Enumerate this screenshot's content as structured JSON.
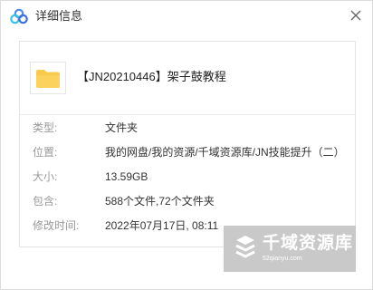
{
  "window": {
    "title": "详细信息",
    "close_symbol": "×",
    "icons": {
      "app": "cloud-logo-icon",
      "close": "close-icon"
    }
  },
  "file": {
    "name": "【JN20210446】架子鼓教程",
    "icon": "folder-icon",
    "icon_color": "#f8c94b"
  },
  "details": [
    {
      "label": "类型:",
      "value": "文件夹"
    },
    {
      "label": "位置:",
      "value": "我的网盘/我的资源/千域资源库/JN技能提升（二）"
    },
    {
      "label": "大小:",
      "value": "13.59GB"
    },
    {
      "label": "包含:",
      "value": "588个文件,72个文件夹"
    },
    {
      "label": "修改时间:",
      "value": "2022年07月17日, 08:11"
    }
  ],
  "watermark": {
    "text": "千域资源库",
    "url": "52qianyu.com",
    "icon": "watermark-logo-icon"
  },
  "colors": {
    "logo_blue": "#4a8df0",
    "logo_cyan": "#35c2e8",
    "folder": "#f8c94b",
    "watermark_bg": "#c9c9c9"
  }
}
